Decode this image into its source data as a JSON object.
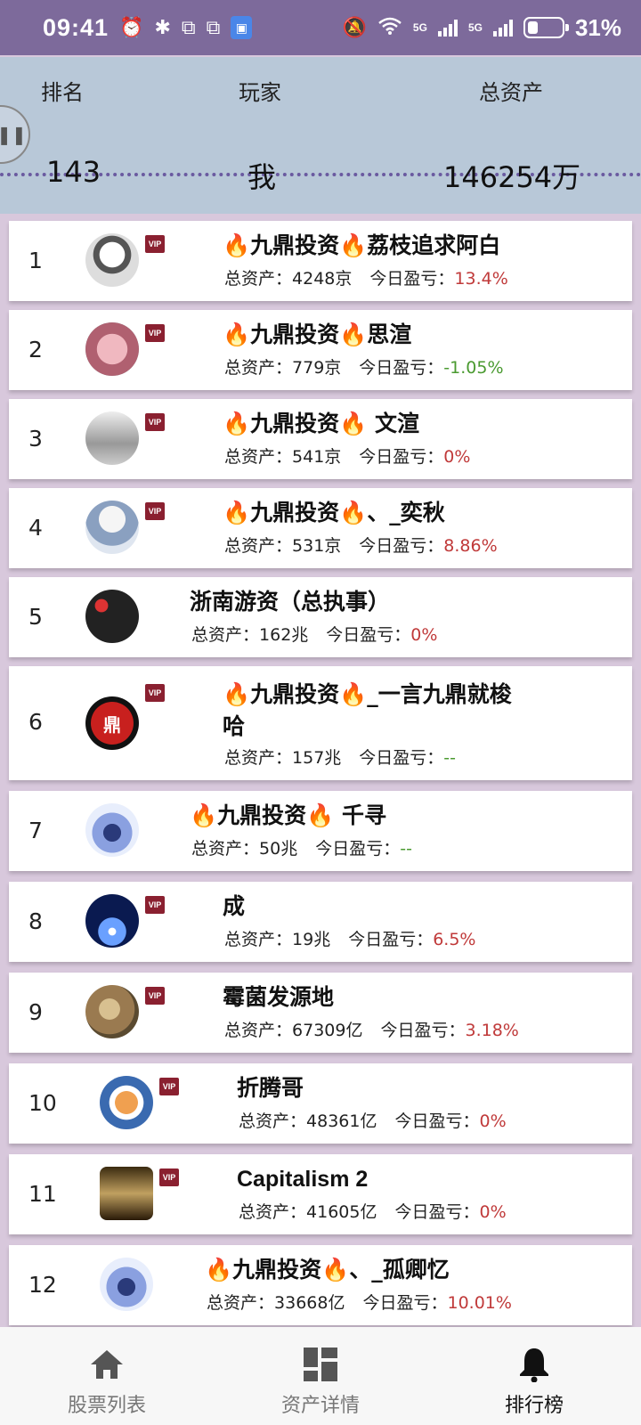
{
  "status": {
    "time": "09:41",
    "battery": "31%",
    "battery_level": 0.31,
    "net1": "5G",
    "net2": "5G"
  },
  "header": {
    "col_rank": "排名",
    "col_player": "玩家",
    "col_assets": "总资产",
    "my_rank": "143",
    "my_name": "我",
    "my_assets": "146254万"
  },
  "rows": [
    {
      "rank": "1",
      "name": "🔥九鼎投资🔥荔枝追求阿白",
      "assets_label": "总资产：",
      "assets": "4248京",
      "pnl_label": "今日盈亏：",
      "pnl": "13.4%",
      "pnl_color": "red",
      "vip": "VIP"
    },
    {
      "rank": "2",
      "name": "🔥九鼎投资🔥思渲",
      "assets_label": "总资产：",
      "assets": "779京",
      "pnl_label": "今日盈亏：",
      "pnl": "-1.05%",
      "pnl_color": "green",
      "vip": "VIP"
    },
    {
      "rank": "3",
      "name": "🔥九鼎投资🔥 文渲",
      "assets_label": "总资产：",
      "assets": "541京",
      "pnl_label": "今日盈亏：",
      "pnl": "0%",
      "pnl_color": "red",
      "vip": "VIP"
    },
    {
      "rank": "4",
      "name": "🔥九鼎投资🔥、_奕秋",
      "assets_label": "总资产：",
      "assets": "531京",
      "pnl_label": "今日盈亏：",
      "pnl": "8.86%",
      "pnl_color": "red",
      "vip": "VIP"
    },
    {
      "rank": "5",
      "name": "浙南游资（总执事）",
      "assets_label": "总资产：",
      "assets": "162兆",
      "pnl_label": "今日盈亏：",
      "pnl": "0%",
      "pnl_color": "red",
      "vip": ""
    },
    {
      "rank": "6",
      "name": "🔥九鼎投资🔥_一言九鼎就梭",
      "name2": "哈",
      "assets_label": "总资产：",
      "assets": "157兆",
      "pnl_label": "今日盈亏：",
      "pnl": "--",
      "pnl_color": "green",
      "vip": "VIP"
    },
    {
      "rank": "7",
      "name": "🔥九鼎投资🔥 千寻",
      "assets_label": "总资产：",
      "assets": "50兆",
      "pnl_label": "今日盈亏：",
      "pnl": "--",
      "pnl_color": "green",
      "vip": ""
    },
    {
      "rank": "8",
      "name": "成",
      "assets_label": "总资产：",
      "assets": "19兆",
      "pnl_label": "今日盈亏：",
      "pnl": "6.5%",
      "pnl_color": "red",
      "vip": "VIP"
    },
    {
      "rank": "9",
      "name": "霉菌发源地",
      "assets_label": "总资产：",
      "assets": "67309亿",
      "pnl_label": "今日盈亏：",
      "pnl": "3.18%",
      "pnl_color": "red",
      "vip": "VIP"
    },
    {
      "rank": "10",
      "name": "折腾哥",
      "assets_label": "总资产：",
      "assets": "48361亿",
      "pnl_label": "今日盈亏：",
      "pnl": "0%",
      "pnl_color": "red",
      "vip": "VIP"
    },
    {
      "rank": "11",
      "name": "Capitalism 2",
      "assets_label": "总资产：",
      "assets": "41605亿",
      "pnl_label": "今日盈亏：",
      "pnl": "0%",
      "pnl_color": "red",
      "vip": "VIP"
    },
    {
      "rank": "12",
      "name": "🔥九鼎投资🔥、_孤卿忆",
      "assets_label": "总资产：",
      "assets": "33668亿",
      "pnl_label": "今日盈亏：",
      "pnl": "10.01%",
      "pnl_color": "red",
      "vip": ""
    }
  ],
  "nav": [
    {
      "label": "股票列表",
      "icon": "home-icon",
      "active": false
    },
    {
      "label": "资产详情",
      "icon": "dashboard-icon",
      "active": false
    },
    {
      "label": "排行榜",
      "icon": "bell-icon",
      "active": true
    }
  ],
  "colors": {
    "statusbar": "#7d6a9b",
    "header": "#b8c8d8",
    "background": "#d8c8dc",
    "up": "#c03a3a",
    "down": "#4a9a30",
    "vip": "#8a2030"
  }
}
